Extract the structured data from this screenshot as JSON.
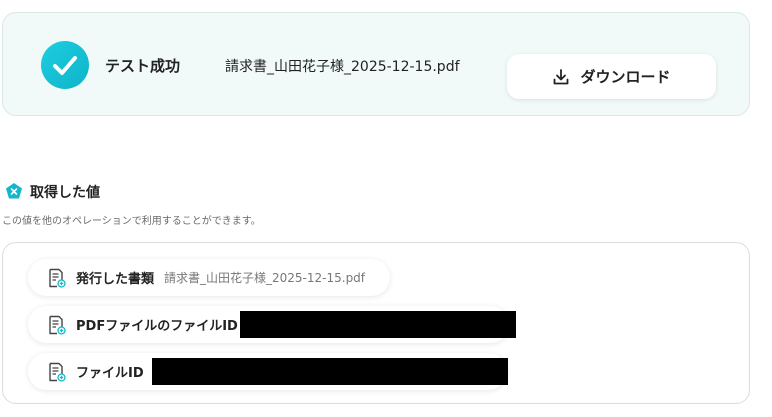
{
  "result": {
    "status_label": "テスト成功",
    "file_name": "請求書_山田花子様_2025-12-15.pdf",
    "download_label": "ダウンロード",
    "accent_color": "#10b4c9"
  },
  "section": {
    "title": "取得した値",
    "description": "この値を他のオペレーションで利用することができます。",
    "icon": "yoom-logo-icon"
  },
  "values": [
    {
      "label": "発行した書類",
      "value": "請求書_山田花子様_2025-12-15.pdf",
      "icon": "document-icon"
    },
    {
      "label": "PDFファイルのファイルID",
      "value": "",
      "redacted": true,
      "icon": "document-icon"
    },
    {
      "label": "ファイルID",
      "value": "",
      "redacted": true,
      "icon": "document-icon"
    }
  ]
}
